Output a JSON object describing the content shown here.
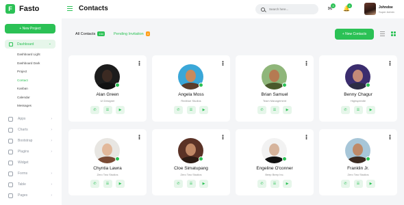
{
  "app": {
    "name": "Fasto",
    "logo_letter": "F"
  },
  "sidebar": {
    "new_project_label": "+ New Project",
    "active_item": "Dashboard",
    "subitems": [
      "Dashboard Light",
      "Dashboard Dark",
      "Project",
      "Contact",
      "Kanban",
      "Calendar",
      "Messages"
    ],
    "selected_subitem": "Contact",
    "menu": [
      {
        "label": "Apps",
        "icon": "apps-icon"
      },
      {
        "label": "Charts",
        "icon": "chart-icon"
      },
      {
        "label": "Bootstrap",
        "icon": "bootstrap-icon"
      },
      {
        "label": "Plugins",
        "icon": "plugin-icon"
      },
      {
        "label": "Widget",
        "icon": "widget-icon"
      },
      {
        "label": "Forms",
        "icon": "forms-icon"
      },
      {
        "label": "Table",
        "icon": "table-icon"
      },
      {
        "label": "Pages",
        "icon": "pages-icon"
      }
    ]
  },
  "header": {
    "title": "Contacts",
    "search_placeholder": "Search here...",
    "mail_count": "3",
    "notification_count": "4",
    "user": {
      "name": "Johndoe",
      "role": "Super Admin"
    }
  },
  "toolbar": {
    "tab_all_label": "All Contacts",
    "tab_all_count": "154",
    "tab_pending_label": "Pending Invitation",
    "tab_pending_count": "4",
    "new_contacts_label": "+ New Contacts"
  },
  "contacts": [
    {
      "name": "Alan Green",
      "role": "UI Designer",
      "colors": {
        "bg": "#1c1c1c",
        "skin": "#3b2a22",
        "shirt": "#111111"
      }
    },
    {
      "name": "Angela Moss",
      "role": "Redblue Studios",
      "colors": {
        "bg": "#3aa7d8",
        "skin": "#c98a5c",
        "shirt": "#5a3d2b"
      }
    },
    {
      "name": "Brian Samuel",
      "role": "Team Management",
      "colors": {
        "bg": "#8fb67a",
        "skin": "#b57a52",
        "shirt": "#4a5a2c"
      }
    },
    {
      "name": "Benny Chagur",
      "role": "Highspeedie",
      "colors": {
        "bg": "#3b2d6e",
        "skin": "#c48a78",
        "shirt": "#2c2c44"
      }
    },
    {
      "name": "Chyntia Lawra",
      "role": "Zero Two Studios",
      "colors": {
        "bg": "#e8e6e2",
        "skin": "#e2b89a",
        "shirt": "#7a4a34"
      }
    },
    {
      "name": "Cloe Simatupang",
      "role": "Zero Two Studios",
      "colors": {
        "bg": "#5b3226",
        "skin": "#c08866",
        "shirt": "#2c1b14"
      }
    },
    {
      "name": "Engeline O'conner",
      "role": "Beep Beep Inc.",
      "colors": {
        "bg": "#f2f2f2",
        "skin": "#d6b49c",
        "shirt": "#111111"
      }
    },
    {
      "name": "Franklin Jr.",
      "role": "Zero Two Studios",
      "colors": {
        "bg": "#a7c6d8",
        "skin": "#bf8a68",
        "shirt": "#3c2a20"
      }
    }
  ],
  "accent_color": "#2bc155"
}
